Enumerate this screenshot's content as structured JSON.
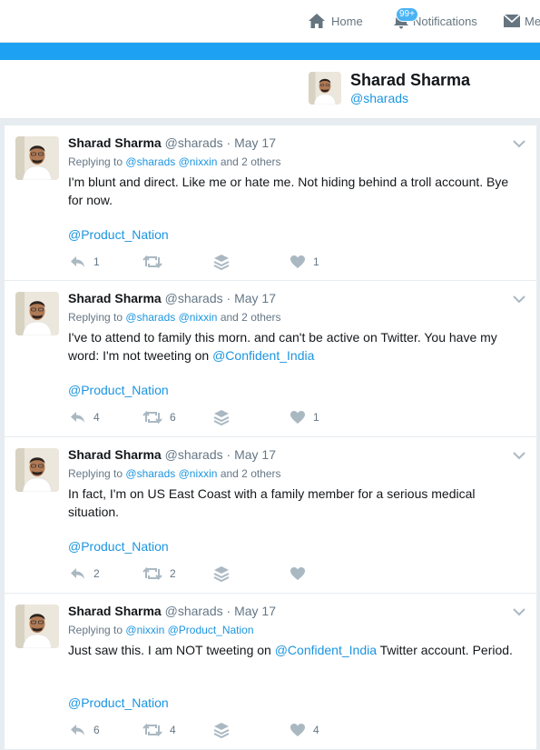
{
  "nav": {
    "home_label": "Home",
    "notifications_label": "Notifications",
    "notifications_badge": "99+",
    "messages_label": "Me"
  },
  "profile": {
    "name": "Sharad Sharma",
    "handle": "@sharads"
  },
  "tweets": [
    {
      "name": "Sharad Sharma",
      "handle": "@sharads",
      "sep": "·",
      "date": "May 17",
      "replying_prefix": "Replying to",
      "replying_links": [
        "@sharads",
        "@nixxin"
      ],
      "replying_suffix": "and 2 others",
      "text_parts": [
        "I'm blunt and direct. Like me or hate me. Not hiding behind a troll account. Bye for now."
      ],
      "signature": "@Product_Nation",
      "replies": "1",
      "retweets": "",
      "likes": "1"
    },
    {
      "name": "Sharad Sharma",
      "handle": "@sharads",
      "sep": "·",
      "date": "May 17",
      "replying_prefix": "Replying to",
      "replying_links": [
        "@sharads",
        "@nixxin"
      ],
      "replying_suffix": "and 2 others",
      "text_parts": [
        "I've to attend to family this morn. and can't be active on Twitter. You have my word: I'm not tweeting on ",
        "@Confident_India",
        ""
      ],
      "signature": "@Product_Nation",
      "replies": "4",
      "retweets": "6",
      "likes": "1"
    },
    {
      "name": "Sharad Sharma",
      "handle": "@sharads",
      "sep": "·",
      "date": "May 17",
      "replying_prefix": "Replying to",
      "replying_links": [
        "@sharads",
        "@nixxin"
      ],
      "replying_suffix": "and 2 others",
      "text_parts": [
        "In fact, I'm on US East Coast with a family member for a serious medical situation."
      ],
      "signature": "@Product_Nation",
      "replies": "2",
      "retweets": "2",
      "likes": ""
    },
    {
      "name": "Sharad Sharma",
      "handle": "@sharads",
      "sep": "·",
      "date": "May 17",
      "replying_prefix": "Replying to",
      "replying_links": [
        "@nixxin",
        "@Product_Nation"
      ],
      "replying_suffix": "",
      "text_parts": [
        "Just saw this. I am NOT tweeting on ",
        "@Confident_India",
        " Twitter account. Period."
      ],
      "signature": "@Product_Nation",
      "replies": "6",
      "retweets": "4",
      "likes": "4"
    }
  ],
  "colors": {
    "brand_blue": "#1da1f2",
    "link_blue": "#1b95e0",
    "muted_gray": "#657786",
    "icon_gray": "#aab8c2",
    "page_bg": "#e6ecf0"
  }
}
